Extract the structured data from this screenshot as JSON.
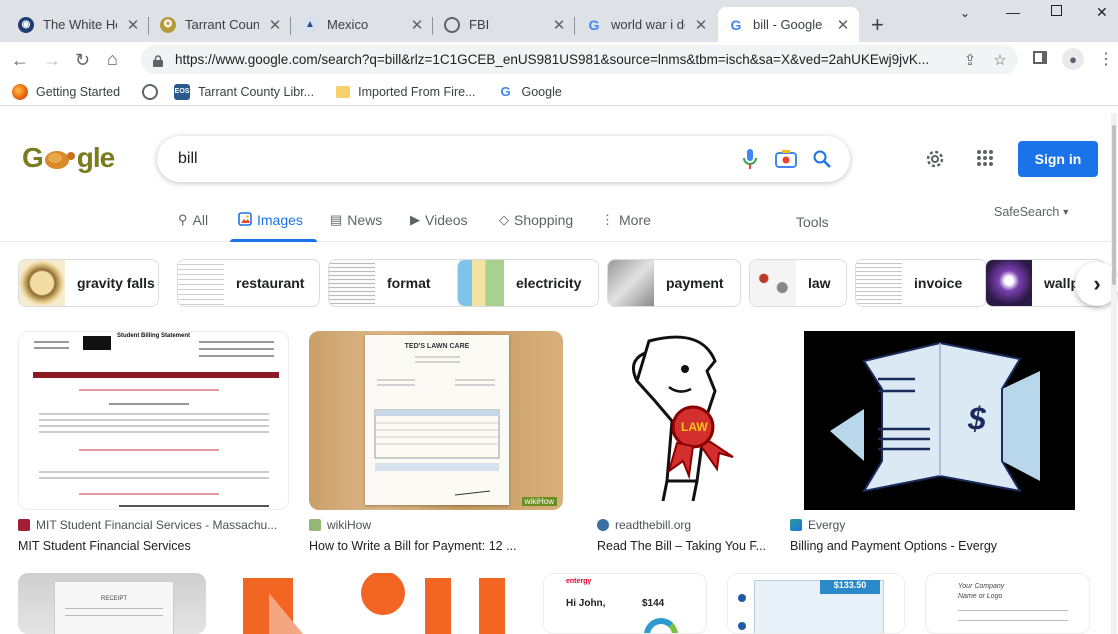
{
  "browser": {
    "tabs": [
      {
        "title": "The White Hou",
        "icon": "white-house-icon"
      },
      {
        "title": "Tarrant County",
        "icon": "tarrant-seal-icon"
      },
      {
        "title": "Mexico",
        "icon": "mexico-icon"
      },
      {
        "title": "FBI",
        "icon": "globe-icon"
      },
      {
        "title": "world war i det",
        "icon": "google-icon"
      },
      {
        "title": "bill - Google S",
        "icon": "google-icon",
        "active": true
      }
    ],
    "url": "https://www.google.com/search?q=bill&rlz=1C1GCEB_enUS981US981&source=lnms&tbm=isch&sa=X&ved=2ahUKEwj9jvK...",
    "bookmarks": [
      {
        "label": "Getting Started",
        "icon": "firefox-icon"
      },
      {
        "label": "",
        "icon": "globe-icon"
      },
      {
        "label": "Tarrant County Libr...",
        "icon": "eos-icon",
        "badge": "EOS"
      },
      {
        "label": "Imported From Fire...",
        "icon": "folder-icon"
      },
      {
        "label": "Google",
        "icon": "google-icon"
      }
    ]
  },
  "search": {
    "logo": "Google",
    "query": "bill",
    "signin": "Sign in",
    "tools": "Tools",
    "safesearch": "SafeSearch",
    "tabs": [
      {
        "label": "All",
        "icon": "search-icon"
      },
      {
        "label": "Images",
        "icon": "image-icon",
        "active": true
      },
      {
        "label": "News",
        "icon": "news-icon"
      },
      {
        "label": "Videos",
        "icon": "video-icon"
      },
      {
        "label": "Shopping",
        "icon": "tag-icon"
      },
      {
        "label": "More",
        "icon": "more-vert-icon"
      }
    ]
  },
  "chips": [
    "gravity falls",
    "restaurant",
    "format",
    "electricity",
    "payment",
    "law",
    "invoice",
    "wallp"
  ],
  "results": [
    {
      "source": "MIT Student Financial Services - Massachu...",
      "caption": "MIT Student Financial Services",
      "image_heading": "Student Billing Statement"
    },
    {
      "source": "wikiHow",
      "caption": "How to Write a Bill for Payment: 12 ...",
      "image_heading": "TED'S LAWN CARE"
    },
    {
      "source": "readthebill.org",
      "caption": "Read The Bill – Taking You F...",
      "image_heading": "LAW"
    },
    {
      "source": "Evergy",
      "caption": "Billing and Payment Options - Evergy",
      "image_heading": "$"
    }
  ],
  "row2": [
    {
      "text": "RECEIPT"
    },
    {
      "text": ""
    },
    {
      "text": "Hi John,",
      "amount": "$144"
    },
    {
      "text": "",
      "amount": "$133.50"
    },
    {
      "text": "Your Company Name or Logo"
    }
  ],
  "colors": {
    "accent": "#1a73e8",
    "logo_olive": "#7a7a1e"
  }
}
